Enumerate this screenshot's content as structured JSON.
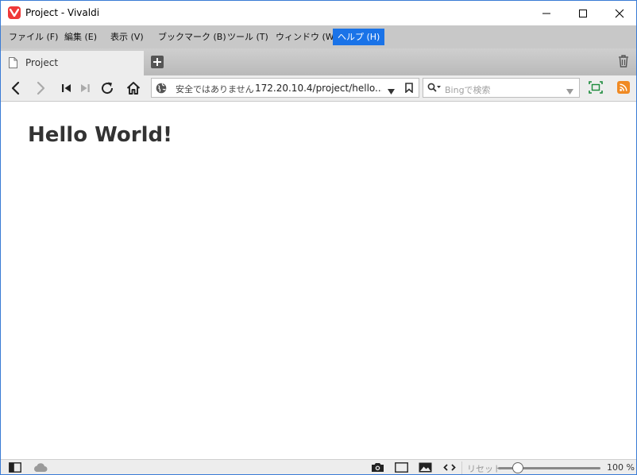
{
  "window": {
    "title": "Project - Vivaldi"
  },
  "menu": [
    {
      "label": "ファイル (F)"
    },
    {
      "label": "編集 (E)"
    },
    {
      "label": "表示 (V)"
    },
    {
      "label": "ブックマーク (B)"
    },
    {
      "label": "ツール (T)"
    },
    {
      "label": "ウィンドウ (W)"
    },
    {
      "label": "ヘルプ (H)",
      "active": true
    }
  ],
  "tabs": [
    {
      "label": "Project"
    }
  ],
  "address": {
    "security": "安全ではありません",
    "url": "172.20.10.4/project/hello..."
  },
  "search": {
    "placeholder": "Bingで検索"
  },
  "page": {
    "heading": "Hello World!"
  },
  "status": {
    "reset": "リセット",
    "zoom": "100 %",
    "zoom_value": 100
  },
  "colors": {
    "accent": "#1a73e8",
    "vivaldi": "#ef3939",
    "rss": "#f08a24"
  }
}
